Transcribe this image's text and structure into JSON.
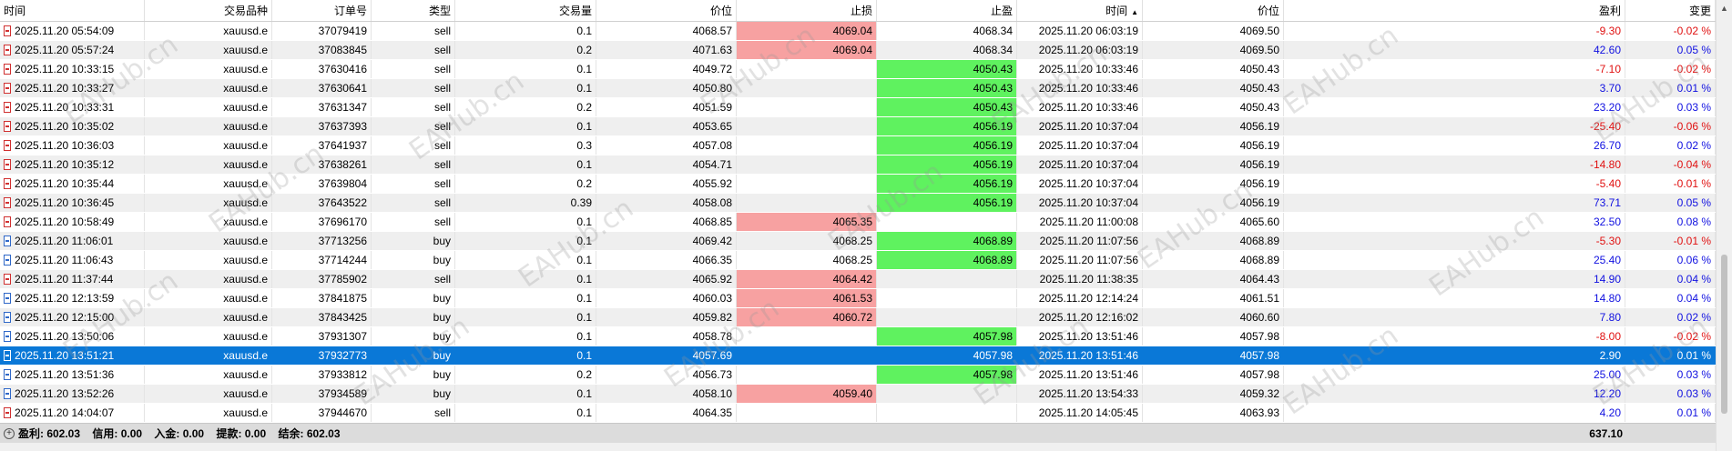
{
  "columns": [
    "时间",
    "交易品种",
    "订单号",
    "类型",
    "交易量",
    "价位",
    "止损",
    "止盈",
    "时间",
    "价位",
    "盈利",
    "变更"
  ],
  "sorted_column_indicator": "▲",
  "rows": [
    {
      "open_time": "2025.11.20 05:54:09",
      "symbol": "xauusd.e",
      "order": "37079419",
      "type": "sell",
      "volume": "0.1",
      "price": "4068.57",
      "sl": "4069.04",
      "tp": "4068.34",
      "close_time": "2025.11.20 06:03:19",
      "close_price": "4069.50",
      "profit": "-9.30",
      "change": "-0.02 %",
      "sl_hl": "red",
      "tp_hl": "",
      "sign": "neg"
    },
    {
      "open_time": "2025.11.20 05:57:24",
      "symbol": "xauusd.e",
      "order": "37083845",
      "type": "sell",
      "volume": "0.2",
      "price": "4071.63",
      "sl": "4069.04",
      "tp": "4068.34",
      "close_time": "2025.11.20 06:03:19",
      "close_price": "4069.50",
      "profit": "42.60",
      "change": "0.05 %",
      "sl_hl": "red",
      "tp_hl": "",
      "sign": "pos"
    },
    {
      "open_time": "2025.11.20 10:33:15",
      "symbol": "xauusd.e",
      "order": "37630416",
      "type": "sell",
      "volume": "0.1",
      "price": "4049.72",
      "sl": "",
      "tp": "4050.43",
      "close_time": "2025.11.20 10:33:46",
      "close_price": "4050.43",
      "profit": "-7.10",
      "change": "-0.02 %",
      "sl_hl": "",
      "tp_hl": "green",
      "sign": "neg"
    },
    {
      "open_time": "2025.11.20 10:33:27",
      "symbol": "xauusd.e",
      "order": "37630641",
      "type": "sell",
      "volume": "0.1",
      "price": "4050.80",
      "sl": "",
      "tp": "4050.43",
      "close_time": "2025.11.20 10:33:46",
      "close_price": "4050.43",
      "profit": "3.70",
      "change": "0.01 %",
      "sl_hl": "",
      "tp_hl": "green",
      "sign": "pos"
    },
    {
      "open_time": "2025.11.20 10:33:31",
      "symbol": "xauusd.e",
      "order": "37631347",
      "type": "sell",
      "volume": "0.2",
      "price": "4051.59",
      "sl": "",
      "tp": "4050.43",
      "close_time": "2025.11.20 10:33:46",
      "close_price": "4050.43",
      "profit": "23.20",
      "change": "0.03 %",
      "sl_hl": "",
      "tp_hl": "green",
      "sign": "pos"
    },
    {
      "open_time": "2025.11.20 10:35:02",
      "symbol": "xauusd.e",
      "order": "37637393",
      "type": "sell",
      "volume": "0.1",
      "price": "4053.65",
      "sl": "",
      "tp": "4056.19",
      "close_time": "2025.11.20 10:37:04",
      "close_price": "4056.19",
      "profit": "-25.40",
      "change": "-0.06 %",
      "sl_hl": "",
      "tp_hl": "green",
      "sign": "neg"
    },
    {
      "open_time": "2025.11.20 10:36:03",
      "symbol": "xauusd.e",
      "order": "37641937",
      "type": "sell",
      "volume": "0.3",
      "price": "4057.08",
      "sl": "",
      "tp": "4056.19",
      "close_time": "2025.11.20 10:37:04",
      "close_price": "4056.19",
      "profit": "26.70",
      "change": "0.02 %",
      "sl_hl": "",
      "tp_hl": "green",
      "sign": "pos"
    },
    {
      "open_time": "2025.11.20 10:35:12",
      "symbol": "xauusd.e",
      "order": "37638261",
      "type": "sell",
      "volume": "0.1",
      "price": "4054.71",
      "sl": "",
      "tp": "4056.19",
      "close_time": "2025.11.20 10:37:04",
      "close_price": "4056.19",
      "profit": "-14.80",
      "change": "-0.04 %",
      "sl_hl": "",
      "tp_hl": "green",
      "sign": "neg"
    },
    {
      "open_time": "2025.11.20 10:35:44",
      "symbol": "xauusd.e",
      "order": "37639804",
      "type": "sell",
      "volume": "0.2",
      "price": "4055.92",
      "sl": "",
      "tp": "4056.19",
      "close_time": "2025.11.20 10:37:04",
      "close_price": "4056.19",
      "profit": "-5.40",
      "change": "-0.01 %",
      "sl_hl": "",
      "tp_hl": "green",
      "sign": "neg"
    },
    {
      "open_time": "2025.11.20 10:36:45",
      "symbol": "xauusd.e",
      "order": "37643522",
      "type": "sell",
      "volume": "0.39",
      "price": "4058.08",
      "sl": "",
      "tp": "4056.19",
      "close_time": "2025.11.20 10:37:04",
      "close_price": "4056.19",
      "profit": "73.71",
      "change": "0.05 %",
      "sl_hl": "",
      "tp_hl": "green",
      "sign": "pos"
    },
    {
      "open_time": "2025.11.20 10:58:49",
      "symbol": "xauusd.e",
      "order": "37696170",
      "type": "sell",
      "volume": "0.1",
      "price": "4068.85",
      "sl": "4065.35",
      "tp": "",
      "close_time": "2025.11.20 11:00:08",
      "close_price": "4065.60",
      "profit": "32.50",
      "change": "0.08 %",
      "sl_hl": "red",
      "tp_hl": "",
      "sign": "pos"
    },
    {
      "open_time": "2025.11.20 11:06:01",
      "symbol": "xauusd.e",
      "order": "37713256",
      "type": "buy",
      "volume": "0.1",
      "price": "4069.42",
      "sl": "4068.25",
      "tp": "4068.89",
      "close_time": "2025.11.20 11:07:56",
      "close_price": "4068.89",
      "profit": "-5.30",
      "change": "-0.01 %",
      "sl_hl": "",
      "tp_hl": "green",
      "sign": "neg"
    },
    {
      "open_time": "2025.11.20 11:06:43",
      "symbol": "xauusd.e",
      "order": "37714244",
      "type": "buy",
      "volume": "0.1",
      "price": "4066.35",
      "sl": "4068.25",
      "tp": "4068.89",
      "close_time": "2025.11.20 11:07:56",
      "close_price": "4068.89",
      "profit": "25.40",
      "change": "0.06 %",
      "sl_hl": "",
      "tp_hl": "green",
      "sign": "pos"
    },
    {
      "open_time": "2025.11.20 11:37:44",
      "symbol": "xauusd.e",
      "order": "37785902",
      "type": "sell",
      "volume": "0.1",
      "price": "4065.92",
      "sl": "4064.42",
      "tp": "",
      "close_time": "2025.11.20 11:38:35",
      "close_price": "4064.43",
      "profit": "14.90",
      "change": "0.04 %",
      "sl_hl": "red",
      "tp_hl": "",
      "sign": "pos"
    },
    {
      "open_time": "2025.11.20 12:13:59",
      "symbol": "xauusd.e",
      "order": "37841875",
      "type": "buy",
      "volume": "0.1",
      "price": "4060.03",
      "sl": "4061.53",
      "tp": "",
      "close_time": "2025.11.20 12:14:24",
      "close_price": "4061.51",
      "profit": "14.80",
      "change": "0.04 %",
      "sl_hl": "red",
      "tp_hl": "",
      "sign": "pos"
    },
    {
      "open_time": "2025.11.20 12:15:00",
      "symbol": "xauusd.e",
      "order": "37843425",
      "type": "buy",
      "volume": "0.1",
      "price": "4059.82",
      "sl": "4060.72",
      "tp": "",
      "close_time": "2025.11.20 12:16:02",
      "close_price": "4060.60",
      "profit": "7.80",
      "change": "0.02 %",
      "sl_hl": "red",
      "tp_hl": "",
      "sign": "pos"
    },
    {
      "open_time": "2025.11.20 13:50:06",
      "symbol": "xauusd.e",
      "order": "37931307",
      "type": "buy",
      "volume": "0.1",
      "price": "4058.78",
      "sl": "",
      "tp": "4057.98",
      "close_time": "2025.11.20 13:51:46",
      "close_price": "4057.98",
      "profit": "-8.00",
      "change": "-0.02 %",
      "sl_hl": "",
      "tp_hl": "green",
      "sign": "neg"
    },
    {
      "open_time": "2025.11.20 13:51:21",
      "symbol": "xauusd.e",
      "order": "37932773",
      "type": "buy",
      "volume": "0.1",
      "price": "4057.69",
      "sl": "",
      "tp": "4057.98",
      "close_time": "2025.11.20 13:51:46",
      "close_price": "4057.98",
      "profit": "2.90",
      "change": "0.01 %",
      "sl_hl": "",
      "tp_hl": "green",
      "sign": "pos",
      "selected": true
    },
    {
      "open_time": "2025.11.20 13:51:36",
      "symbol": "xauusd.e",
      "order": "37933812",
      "type": "buy",
      "volume": "0.2",
      "price": "4056.73",
      "sl": "",
      "tp": "4057.98",
      "close_time": "2025.11.20 13:51:46",
      "close_price": "4057.98",
      "profit": "25.00",
      "change": "0.03 %",
      "sl_hl": "",
      "tp_hl": "green",
      "sign": "pos"
    },
    {
      "open_time": "2025.11.20 13:52:26",
      "symbol": "xauusd.e",
      "order": "37934589",
      "type": "buy",
      "volume": "0.1",
      "price": "4058.10",
      "sl": "4059.40",
      "tp": "",
      "close_time": "2025.11.20 13:54:33",
      "close_price": "4059.32",
      "profit": "12.20",
      "change": "0.03 %",
      "sl_hl": "red",
      "tp_hl": "",
      "sign": "pos"
    },
    {
      "open_time": "2025.11.20 14:04:07",
      "symbol": "xauusd.e",
      "order": "37944670",
      "type": "sell",
      "volume": "0.1",
      "price": "4064.35",
      "sl": "",
      "tp": "",
      "close_time": "2025.11.20 14:05:45",
      "close_price": "4063.93",
      "profit": "4.20",
      "change": "0.01 %",
      "sl_hl": "",
      "tp_hl": "",
      "sign": "pos"
    }
  ],
  "footer": {
    "profit": "盈利: 602.03",
    "credit": "信用: 0.00",
    "deposit": "入金: 0.00",
    "withdraw": "提款: 0.00",
    "balance": "结余: 602.03",
    "total_profit": "637.10"
  },
  "watermark": "EAHub.cn",
  "colors": {
    "selected_row": "#0a78d7",
    "sl_highlight": "#f7a1a1",
    "tp_highlight": "#5ff25f",
    "negative_text": "#e01010",
    "positive_text": "#1010e0"
  },
  "scrollbar_up_icon": "▲"
}
